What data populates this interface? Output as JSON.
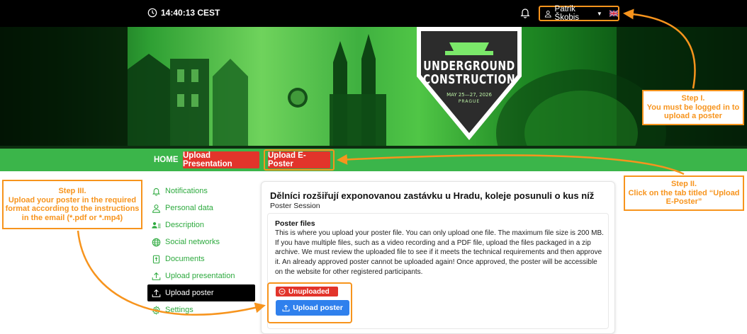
{
  "topbar": {
    "time": "14:40:13 CEST",
    "user_name": "Patrik Škobis",
    "icons": {
      "clock": "clock-icon",
      "bell": "bell-icon",
      "user": "user-icon",
      "flag": "uk-flag-icon"
    }
  },
  "banner": {
    "title_line1": "UNDERGROUND",
    "title_line2": "CONSTRUCTION",
    "dates": "MAY 25—27, 2026",
    "city": "PRAGUE"
  },
  "nav": {
    "home": "HOME",
    "tabs": [
      {
        "label": "Upload Presentation"
      },
      {
        "label": "Upload E-Poster"
      }
    ]
  },
  "sidebar": {
    "items": [
      {
        "label": "Notifications",
        "icon": "bell-icon"
      },
      {
        "label": "Personal data",
        "icon": "user-icon"
      },
      {
        "label": "Description",
        "icon": "user-list-icon"
      },
      {
        "label": "Social networks",
        "icon": "globe-icon"
      },
      {
        "label": "Documents",
        "icon": "document-icon"
      },
      {
        "label": "Upload presentation",
        "icon": "upload-icon"
      },
      {
        "label": "Upload poster",
        "icon": "upload-icon",
        "active": true
      },
      {
        "label": "Settings",
        "icon": "gear-icon"
      }
    ]
  },
  "main": {
    "title": "Dělníci rozšiřují exponovanou zastávku u Hradu, koleje posunuli o kus níž",
    "subtitle": "Poster Session",
    "section_title": "Poster files",
    "section_text": "This is where you upload your poster file. You can only upload one file. The maximum file size is 200 MB. If you have multiple files, such as a video recording and a PDF file, upload the files packaged in a zip archive. We must review the uploaded file to see if it meets the technical requirements and then approve it. An already approved poster cannot be uploaded again! Once approved, the poster will be accessible on the website for other registered participants.",
    "status": "Unuploaded",
    "upload_button": "Upload poster"
  },
  "callouts": {
    "step1": {
      "title": "Step I.",
      "text": "You must be logged in to upload a poster"
    },
    "step2": {
      "title": "Step II.",
      "text": "Click on the tab titled “Upload E-Poster”"
    },
    "step3": {
      "title": "Step III.",
      "text": "Upload your poster in the required format according to the instructions in the email (*.pdf or *.mp4)"
    }
  },
  "colors": {
    "accent_orange": "#f7941d",
    "nav_green": "#3bb54a",
    "tab_red": "#e2342b",
    "link_green": "#2eaa3f",
    "button_blue": "#2f80ed"
  }
}
